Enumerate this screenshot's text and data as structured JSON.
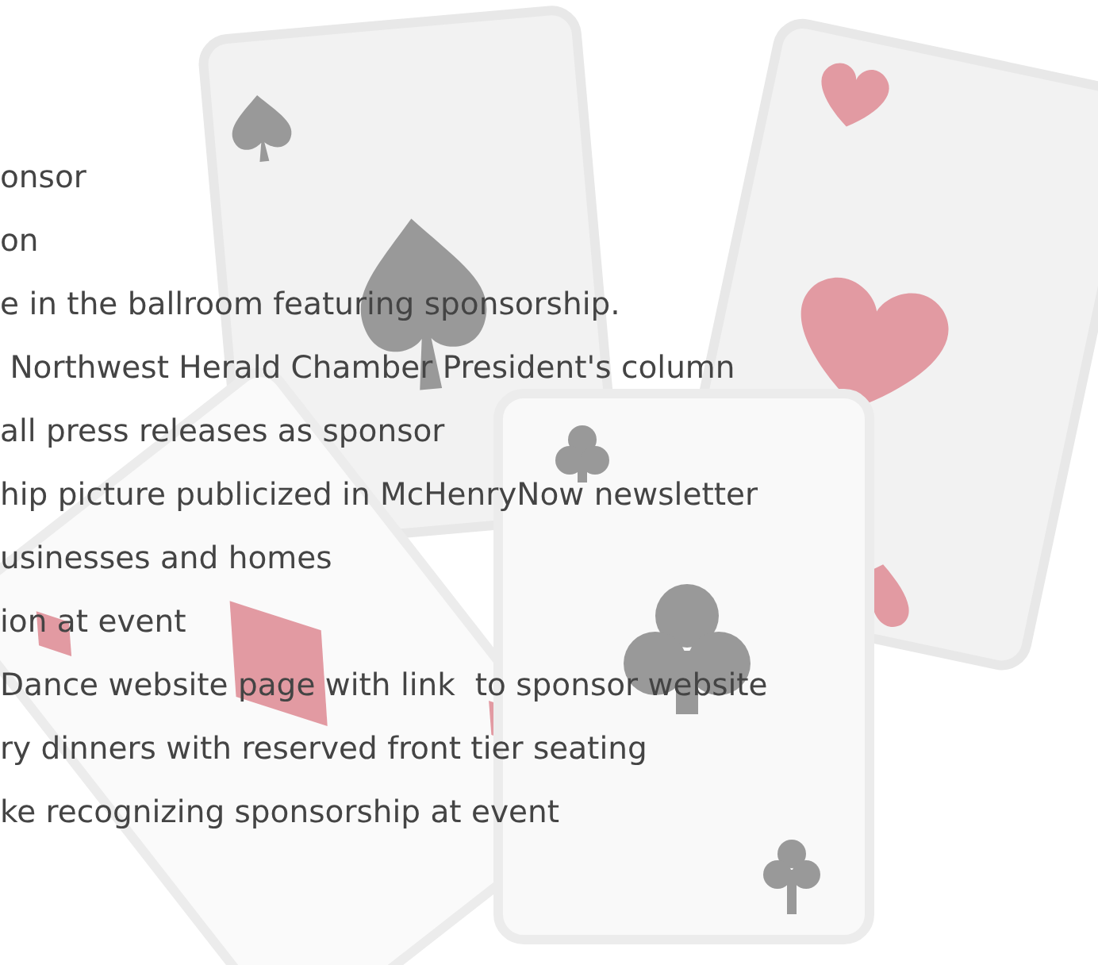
{
  "benefits": [
    "onsor",
    "on",
    "e in the ballroom featuring sponsorship.",
    " Northwest Herald Chamber President's column",
    "all press releases as sponsor",
    "hip picture publicized in McHenryNow newsletter",
    "usinesses and homes",
    "ion at event",
    "Dance website page with link  to sponsor website",
    "ry dinners with reserved front tier seating",
    "ke recognizing sponsorship at event"
  ]
}
